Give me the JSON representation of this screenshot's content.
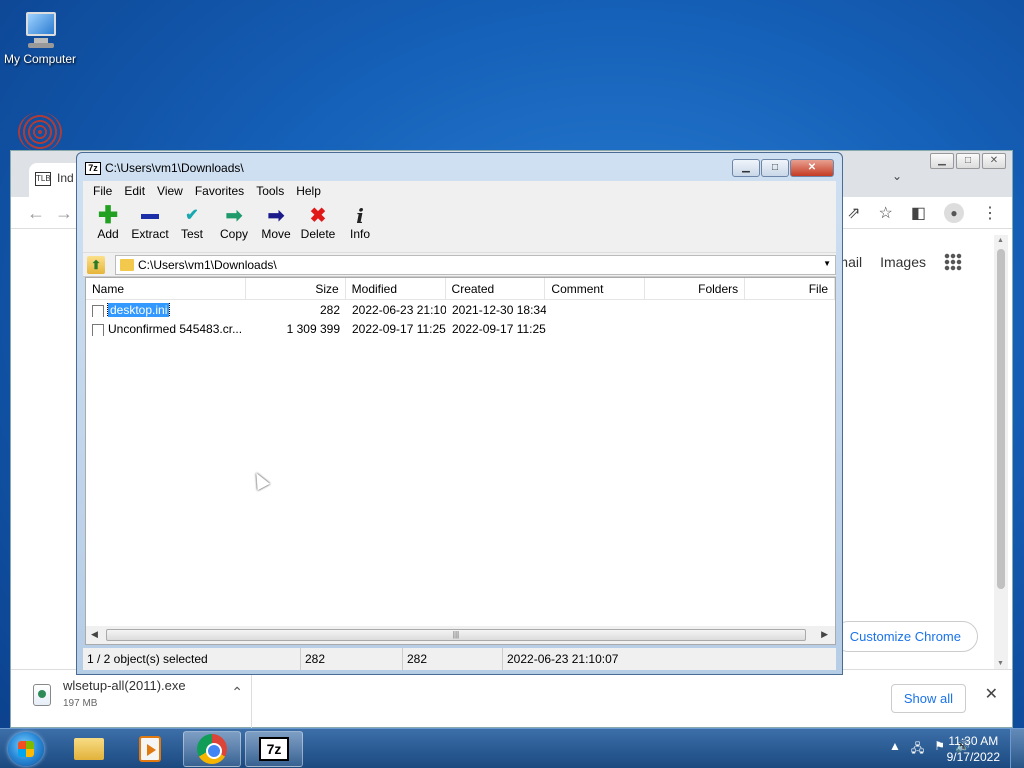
{
  "desktop": {
    "icons": [
      {
        "label": "My Computer",
        "icon": "computer-icon"
      },
      {
        "label": "",
        "icon": "app-icon"
      }
    ]
  },
  "chrome": {
    "tab_title": "Ind",
    "tab_favicon": "TLB",
    "links": {
      "gmail": "mail",
      "images": "Images"
    },
    "customize_label": "Customize Chrome",
    "download": {
      "filename": "wlsetup-all(2011).exe",
      "size": "197 MB"
    },
    "show_all_label": "Show all"
  },
  "sevenzip": {
    "title": "C:\\Users\\vm1\\Downloads\\",
    "icon_label": "7z",
    "menu": [
      "File",
      "Edit",
      "View",
      "Favorites",
      "Tools",
      "Help"
    ],
    "toolbar": [
      {
        "label": "Add",
        "icon": "add-icon",
        "glyph": "✚"
      },
      {
        "label": "Extract",
        "icon": "extract-icon",
        "glyph": ""
      },
      {
        "label": "Test",
        "icon": "test-icon",
        "glyph": "✔"
      },
      {
        "label": "Copy",
        "icon": "copy-icon",
        "glyph": "➡"
      },
      {
        "label": "Move",
        "icon": "move-icon",
        "glyph": "➡"
      },
      {
        "label": "Delete",
        "icon": "delete-icon",
        "glyph": "✖"
      },
      {
        "label": "Info",
        "icon": "info-icon",
        "glyph": "i"
      }
    ],
    "address": "C:\\Users\\vm1\\Downloads\\",
    "columns": {
      "name": "Name",
      "size": "Size",
      "modified": "Modified",
      "created": "Created",
      "comment": "Comment",
      "folders": "Folders",
      "files": "File"
    },
    "files": [
      {
        "name": "desktop.ini",
        "size": "282",
        "modified": "2022-06-23 21:10",
        "created": "2021-12-30 18:34",
        "selected": true
      },
      {
        "name": "Unconfirmed 545483.cr...",
        "size": "1 309 399",
        "modified": "2022-09-17 11:25",
        "created": "2022-09-17 11:25",
        "selected": false
      }
    ],
    "status": {
      "selection": "1 / 2 object(s) selected",
      "size": "282",
      "packed": "282",
      "modified": "2022-06-23 21:10:07"
    }
  },
  "taskbar": {
    "time": "11:30 AM",
    "date": "9/17/2022",
    "apps": [
      "explorer",
      "media-player",
      "chrome",
      "7-zip"
    ],
    "sevenzip_label": "7z"
  }
}
